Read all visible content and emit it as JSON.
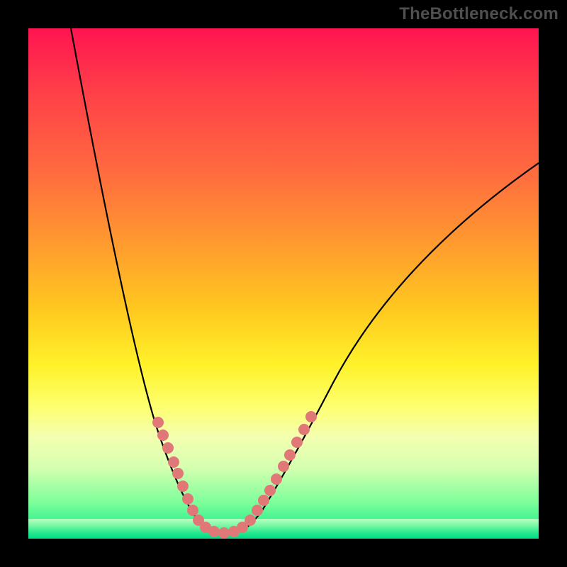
{
  "watermark": "TheBottleneck.com",
  "colors": {
    "background": "#000000",
    "curve": "#000000",
    "marker": "#e07878",
    "gradient_top": "#ff1450",
    "gradient_bottom": "#00de86"
  },
  "chart_data": {
    "type": "line",
    "title": "",
    "xlabel": "",
    "ylabel": "",
    "xlim": [
      0,
      100
    ],
    "ylim": [
      0,
      100
    ],
    "description": "V-shaped bottleneck curve on a vertical red-to-green gradient. Lower y (toward green) denotes smaller bottleneck. Pink circular markers populate the lower portion of both arms and the trough.",
    "series": [
      {
        "name": "bottleneck_curve",
        "x": [
          8,
          15,
          22,
          26,
          30,
          34,
          37,
          40,
          45,
          50,
          58,
          68,
          82,
          100
        ],
        "y": [
          100,
          60,
          35,
          22,
          12,
          4,
          1,
          1,
          6,
          15,
          30,
          48,
          64,
          74
        ]
      }
    ],
    "markers": {
      "name": "highlighted_points",
      "x": [
        25.4,
        26.4,
        27.4,
        28.5,
        29.3,
        30.3,
        31.3,
        32.2,
        33.3,
        34.7,
        36.4,
        38.3,
        40.3,
        41.9,
        43.5,
        44.9,
        46.1,
        47.4,
        48.6,
        50.0,
        51.3,
        52.6,
        54.0,
        55.4
      ],
      "y": [
        22.8,
        20.3,
        17.8,
        15.0,
        12.8,
        10.3,
        7.8,
        5.6,
        3.6,
        2.2,
        1.4,
        1.1,
        1.4,
        2.2,
        3.6,
        5.6,
        7.5,
        9.4,
        11.7,
        14.2,
        16.4,
        18.9,
        21.4,
        23.9
      ]
    },
    "background_gradient": {
      "orientation": "vertical",
      "stops": [
        {
          "pos": 0.0,
          "color": "#ff1450"
        },
        {
          "pos": 0.28,
          "color": "#ff6a3f"
        },
        {
          "pos": 0.55,
          "color": "#ffc81f"
        },
        {
          "pos": 0.74,
          "color": "#fdff6e"
        },
        {
          "pos": 0.93,
          "color": "#7cff9a"
        },
        {
          "pos": 1.0,
          "color": "#00de86"
        }
      ]
    }
  }
}
